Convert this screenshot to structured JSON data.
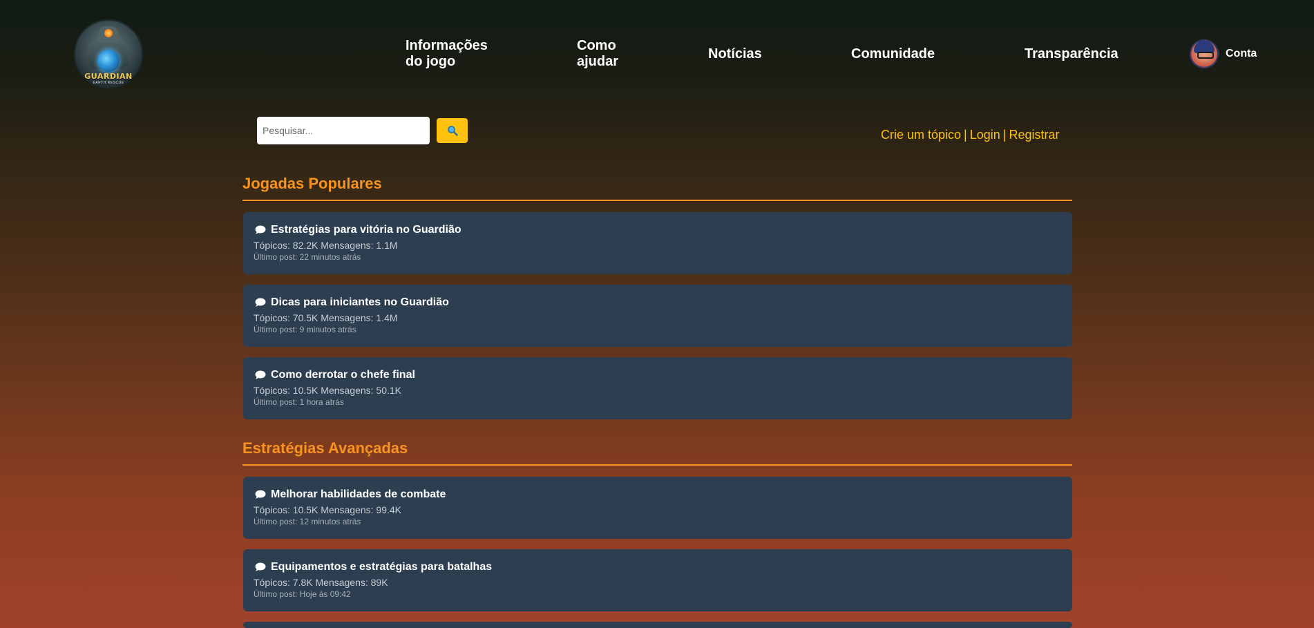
{
  "header": {
    "logo_text": "GUARDIAN",
    "logo_sub": "EARTH RESCUE",
    "nav": [
      {
        "label": "Informações do jogo"
      },
      {
        "label": "Como ajudar"
      },
      {
        "label": "Notícias"
      },
      {
        "label": "Comunidade"
      },
      {
        "label": "Transparência"
      }
    ],
    "account_label": "Conta"
  },
  "search": {
    "placeholder": "Pesquisar...",
    "value": "",
    "button_icon": "magnifier-icon"
  },
  "user_links": {
    "create_topic": "Crie um tópico",
    "separator": "|",
    "login": "Login",
    "register": "Registrar"
  },
  "sections": [
    {
      "title": "Jogadas Populares",
      "forums": [
        {
          "title": "Estratégias para vitória no Guardião",
          "stats": "Tópicos: 82.2K Mensagens: 1.1M",
          "last_post": "Último post: 22 minutos atrás"
        },
        {
          "title": "Dicas para iniciantes no Guardião",
          "stats": "Tópicos: 70.5K Mensagens: 1.4M",
          "last_post": "Último post: 9 minutos atrás"
        },
        {
          "title": "Como derrotar o chefe final",
          "stats": "Tópicos: 10.5K Mensagens: 50.1K",
          "last_post": "Último post: 1 hora atrás"
        }
      ]
    },
    {
      "title": "Estratégias Avançadas",
      "forums": [
        {
          "title": "Melhorar habilidades de combate",
          "stats": "Tópicos: 10.5K Mensagens: 99.4K",
          "last_post": "Último post: 12 minutos atrás"
        },
        {
          "title": "Equipamentos e estratégias para batalhas",
          "stats": "Tópicos: 7.8K Mensagens: 89K",
          "last_post": "Último post: Hoje às 09:42"
        }
      ]
    }
  ],
  "icons": {
    "forum": "speech-bubble-icon"
  },
  "colors": {
    "accent": "#f7931e",
    "link": "#ffc20e",
    "card_bg": "#2c3e50"
  }
}
